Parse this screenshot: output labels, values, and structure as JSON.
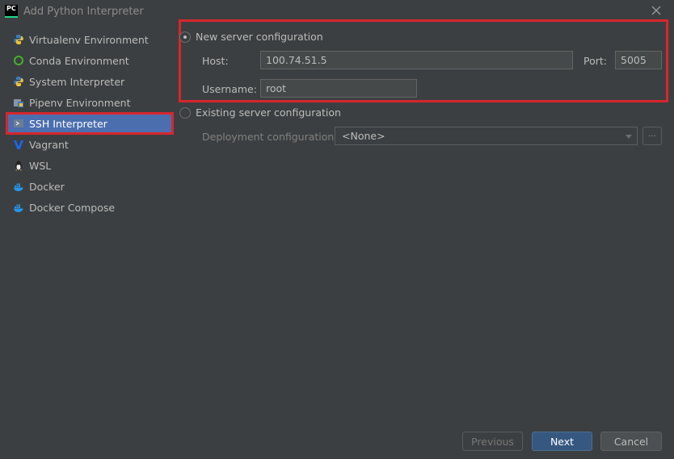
{
  "window": {
    "title": "Add Python Interpreter",
    "logo_text": "PC"
  },
  "sidebar": {
    "items": [
      {
        "label": "Virtualenv Environment",
        "icon": "python-icon"
      },
      {
        "label": "Conda Environment",
        "icon": "conda-icon"
      },
      {
        "label": "System Interpreter",
        "icon": "python-icon"
      },
      {
        "label": "Pipenv Environment",
        "icon": "pipenv-icon"
      },
      {
        "label": "SSH Interpreter",
        "icon": "terminal-icon",
        "selected": true
      },
      {
        "label": "Vagrant",
        "icon": "vagrant-icon"
      },
      {
        "label": "WSL",
        "icon": "linux-icon"
      },
      {
        "label": "Docker",
        "icon": "docker-icon"
      },
      {
        "label": "Docker Compose",
        "icon": "docker-icon"
      }
    ]
  },
  "new_server": {
    "label": "New server configuration",
    "host_label": "Host:",
    "host_value": "100.74.51.5",
    "port_label": "Port:",
    "port_value": "5005",
    "username_label": "Username:",
    "username_value": "root"
  },
  "existing_server": {
    "label": "Existing server configuration",
    "deployment_label": "Deployment configuration:",
    "deployment_value": "<None>",
    "browse_label": "..."
  },
  "buttons": {
    "previous": "Previous",
    "next": "Next",
    "cancel": "Cancel"
  },
  "colors": {
    "background": "#3c3f41",
    "selection": "#4b6eaf",
    "highlight": "#d7262d",
    "primary": "#365880"
  }
}
